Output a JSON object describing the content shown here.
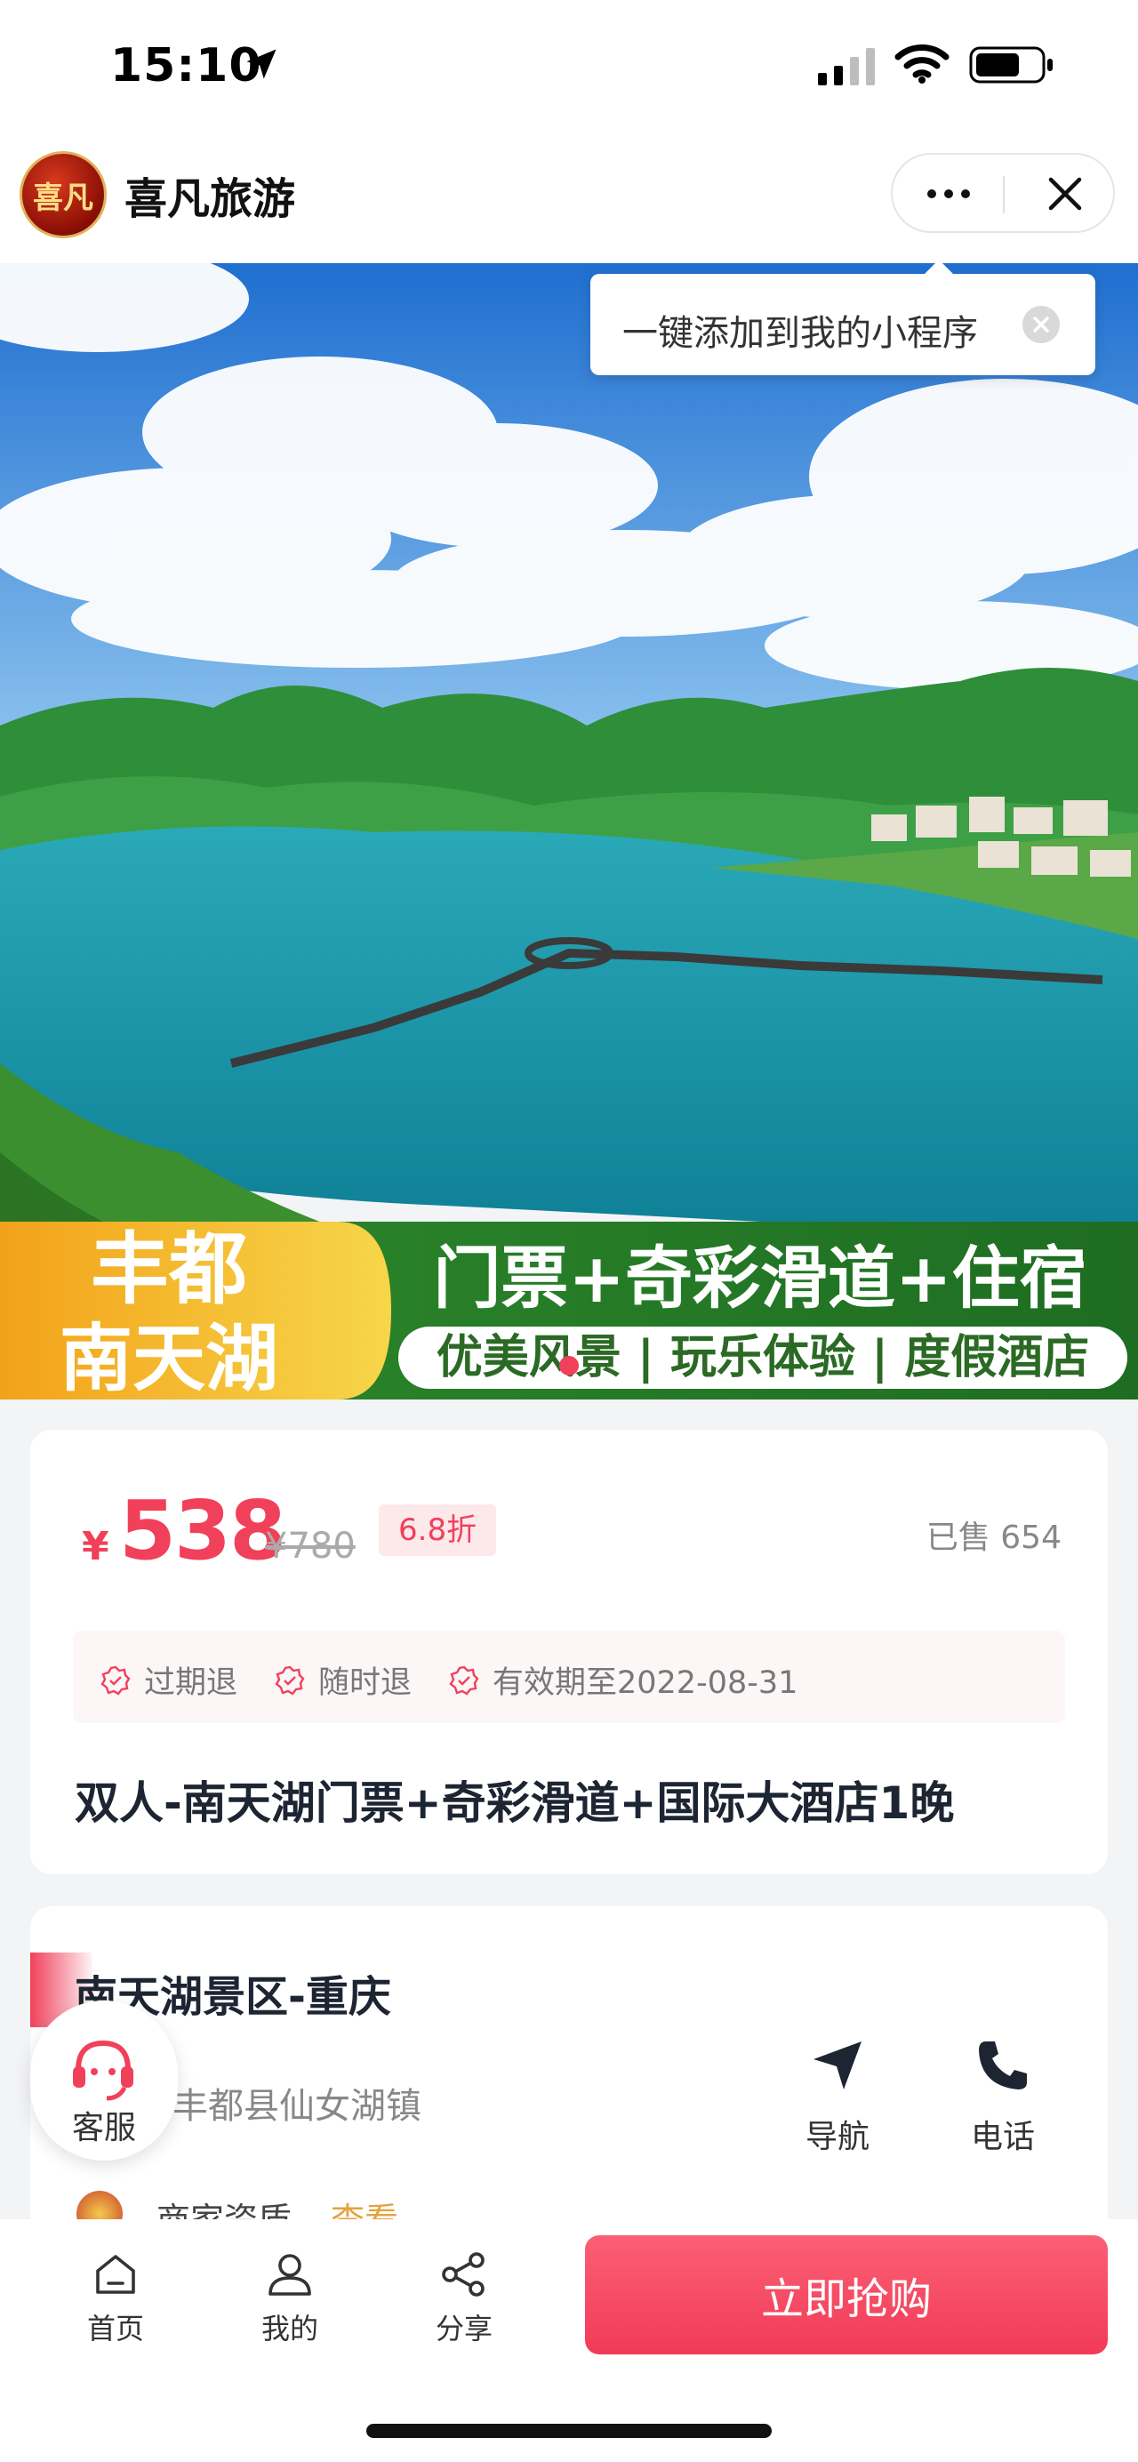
{
  "status_bar": {
    "time": "15:10"
  },
  "header": {
    "app_title": "喜凡旅游",
    "logo_text": "喜凡"
  },
  "tooltip": {
    "text": "一键添加到我的小程序"
  },
  "banner": {
    "place_line1": "丰都",
    "place_line2": "南天湖",
    "headline": "门票+奇彩滑道+住宿",
    "subline": "优美风景 | 玩乐体验 | 度假酒店"
  },
  "product": {
    "currency": "¥",
    "price": "538",
    "original_price": "¥780",
    "discount": "6.8折",
    "sold": "已售 654",
    "tags": [
      "过期退",
      "随时退",
      "有效期至2022-08-31"
    ],
    "title": "双人-南天湖门票+奇彩滑道+国际大酒店1晚"
  },
  "venue": {
    "name": "南天湖景区-重庆",
    "address": "市丰都县仙女湖镇",
    "navigate_label": "导航",
    "call_label": "电话",
    "qualification_label": "商家资质",
    "qualification_link": "查看"
  },
  "service": {
    "label": "客服"
  },
  "bottom_bar": {
    "tabs": [
      {
        "label": "首页",
        "icon": "home-icon"
      },
      {
        "label": "我的",
        "icon": "user-icon"
      },
      {
        "label": "分享",
        "icon": "share-icon"
      }
    ],
    "buy_label": "立即抢购"
  },
  "colors": {
    "accent": "#f0405a",
    "link": "#e6a23c"
  }
}
